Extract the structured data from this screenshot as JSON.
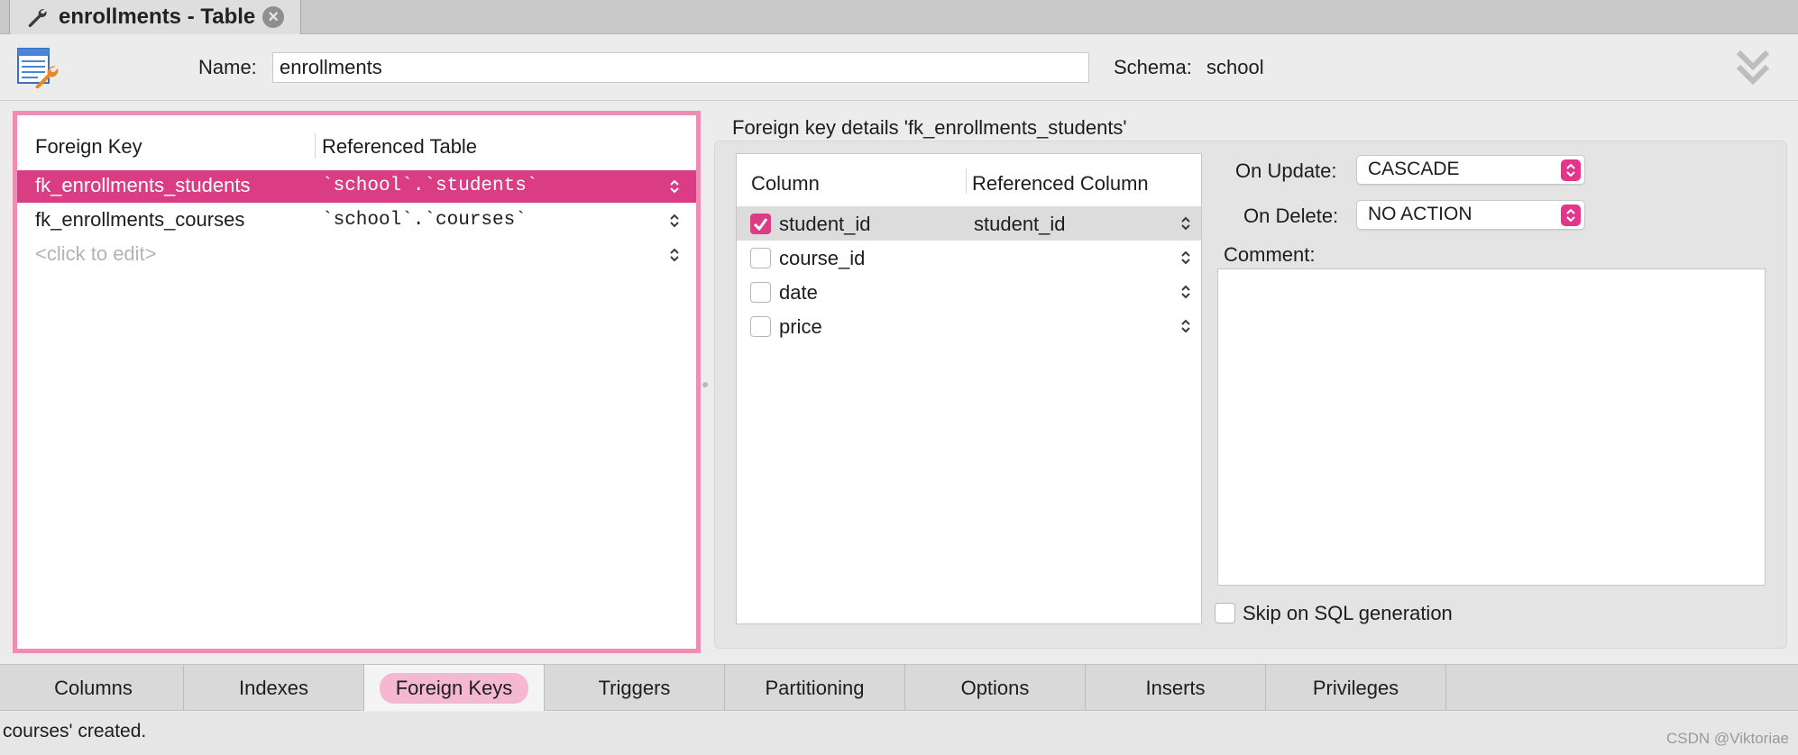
{
  "window_tab": {
    "title": "enrollments - Table",
    "close_icon": "close-icon",
    "wrench_icon": "wrench-icon"
  },
  "header": {
    "name_label": "Name:",
    "name_value": "enrollments",
    "schema_label": "Schema:",
    "schema_value": "school"
  },
  "fk_list": {
    "col_foreign_key": "Foreign Key",
    "col_referenced_table": "Referenced Table",
    "rows": [
      {
        "name": "fk_enrollments_students",
        "table": "`school`.`students`",
        "selected": true
      },
      {
        "name": "fk_enrollments_courses",
        "table": "`school`.`courses`",
        "selected": false
      }
    ],
    "new_row_placeholder": "<click to edit>"
  },
  "details": {
    "title": "Foreign key details 'fk_enrollments_students'",
    "col_column": "Column",
    "col_referenced_column": "Referenced Column",
    "columns": [
      {
        "name": "student_id",
        "checked": true,
        "ref": "student_id"
      },
      {
        "name": "course_id",
        "checked": false,
        "ref": ""
      },
      {
        "name": "date",
        "checked": false,
        "ref": ""
      },
      {
        "name": "price",
        "checked": false,
        "ref": ""
      }
    ],
    "on_update_label": "On Update:",
    "on_update_value": "CASCADE",
    "on_delete_label": "On Delete:",
    "on_delete_value": "NO ACTION",
    "comment_label": "Comment:",
    "comment_value": "",
    "skip_label": "Skip on SQL generation"
  },
  "bottom_tabs": [
    {
      "label": "Columns",
      "active": false
    },
    {
      "label": "Indexes",
      "active": false
    },
    {
      "label": "Foreign Keys",
      "active": true
    },
    {
      "label": "Triggers",
      "active": false
    },
    {
      "label": "Partitioning",
      "active": false
    },
    {
      "label": "Options",
      "active": false
    },
    {
      "label": "Inserts",
      "active": false
    },
    {
      "label": "Privileges",
      "active": false
    }
  ],
  "status": {
    "text": "courses' created.",
    "watermark": "CSDN @Viktoriae"
  },
  "colors": {
    "accent": "#db3d84",
    "selection_border": "#ee8db6",
    "active_tab_pill": "#f5b8d0"
  }
}
